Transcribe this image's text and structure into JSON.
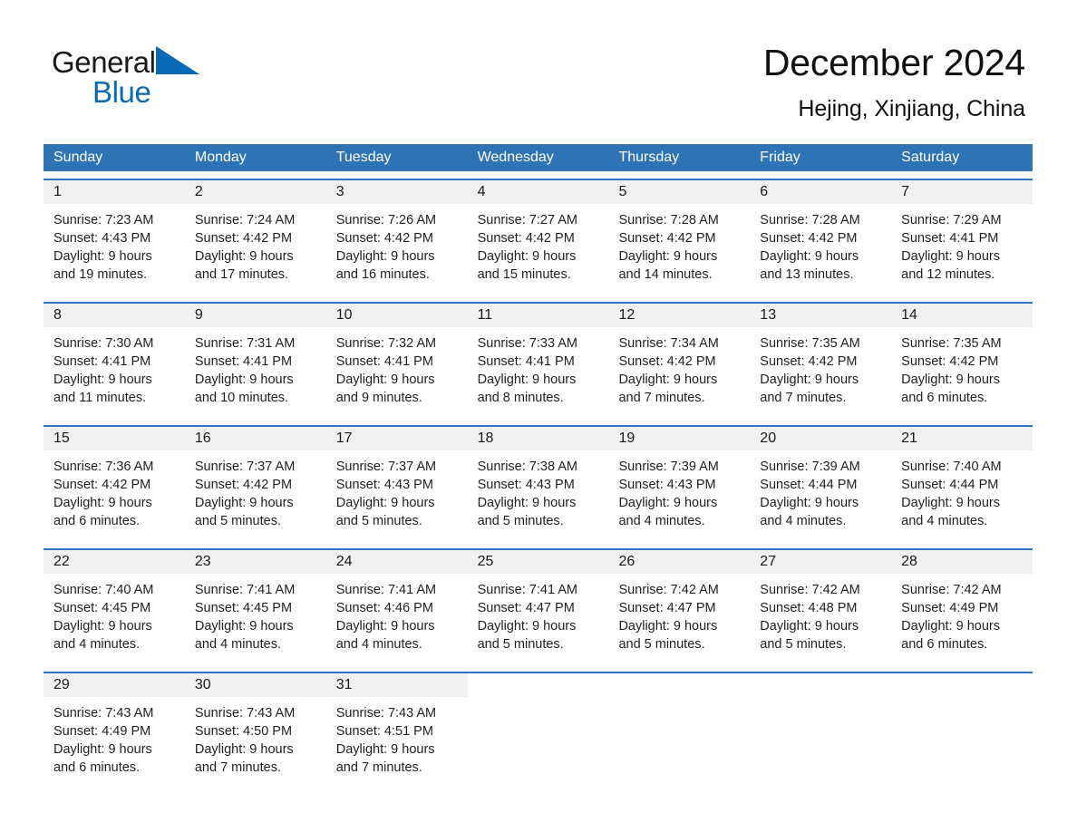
{
  "brand": {
    "word1": "General",
    "word2": "Blue",
    "triangle_color": "#0b68b2",
    "logo_text_color": "#1a1a1a"
  },
  "header": {
    "title": "December 2024",
    "subtitle": "Hejing, Xinjiang, China"
  },
  "theme": {
    "header_blue": "#2e74b5",
    "daynum_band": "#f0f0f0",
    "text": "#1a1a1a"
  },
  "weekday_headers": [
    "Sunday",
    "Monday",
    "Tuesday",
    "Wednesday",
    "Thursday",
    "Friday",
    "Saturday"
  ],
  "weeks": [
    {
      "days": [
        {
          "num": "1",
          "sunrise": "Sunrise: 7:23 AM",
          "sunset": "Sunset: 4:43 PM",
          "daylight1": "Daylight: 9 hours",
          "daylight2": "and 19 minutes."
        },
        {
          "num": "2",
          "sunrise": "Sunrise: 7:24 AM",
          "sunset": "Sunset: 4:42 PM",
          "daylight1": "Daylight: 9 hours",
          "daylight2": "and 17 minutes."
        },
        {
          "num": "3",
          "sunrise": "Sunrise: 7:26 AM",
          "sunset": "Sunset: 4:42 PM",
          "daylight1": "Daylight: 9 hours",
          "daylight2": "and 16 minutes."
        },
        {
          "num": "4",
          "sunrise": "Sunrise: 7:27 AM",
          "sunset": "Sunset: 4:42 PM",
          "daylight1": "Daylight: 9 hours",
          "daylight2": "and 15 minutes."
        },
        {
          "num": "5",
          "sunrise": "Sunrise: 7:28 AM",
          "sunset": "Sunset: 4:42 PM",
          "daylight1": "Daylight: 9 hours",
          "daylight2": "and 14 minutes."
        },
        {
          "num": "6",
          "sunrise": "Sunrise: 7:28 AM",
          "sunset": "Sunset: 4:42 PM",
          "daylight1": "Daylight: 9 hours",
          "daylight2": "and 13 minutes."
        },
        {
          "num": "7",
          "sunrise": "Sunrise: 7:29 AM",
          "sunset": "Sunset: 4:41 PM",
          "daylight1": "Daylight: 9 hours",
          "daylight2": "and 12 minutes."
        }
      ]
    },
    {
      "days": [
        {
          "num": "8",
          "sunrise": "Sunrise: 7:30 AM",
          "sunset": "Sunset: 4:41 PM",
          "daylight1": "Daylight: 9 hours",
          "daylight2": "and 11 minutes."
        },
        {
          "num": "9",
          "sunrise": "Sunrise: 7:31 AM",
          "sunset": "Sunset: 4:41 PM",
          "daylight1": "Daylight: 9 hours",
          "daylight2": "and 10 minutes."
        },
        {
          "num": "10",
          "sunrise": "Sunrise: 7:32 AM",
          "sunset": "Sunset: 4:41 PM",
          "daylight1": "Daylight: 9 hours",
          "daylight2": "and 9 minutes."
        },
        {
          "num": "11",
          "sunrise": "Sunrise: 7:33 AM",
          "sunset": "Sunset: 4:41 PM",
          "daylight1": "Daylight: 9 hours",
          "daylight2": "and 8 minutes."
        },
        {
          "num": "12",
          "sunrise": "Sunrise: 7:34 AM",
          "sunset": "Sunset: 4:42 PM",
          "daylight1": "Daylight: 9 hours",
          "daylight2": "and 7 minutes."
        },
        {
          "num": "13",
          "sunrise": "Sunrise: 7:35 AM",
          "sunset": "Sunset: 4:42 PM",
          "daylight1": "Daylight: 9 hours",
          "daylight2": "and 7 minutes."
        },
        {
          "num": "14",
          "sunrise": "Sunrise: 7:35 AM",
          "sunset": "Sunset: 4:42 PM",
          "daylight1": "Daylight: 9 hours",
          "daylight2": "and 6 minutes."
        }
      ]
    },
    {
      "days": [
        {
          "num": "15",
          "sunrise": "Sunrise: 7:36 AM",
          "sunset": "Sunset: 4:42 PM",
          "daylight1": "Daylight: 9 hours",
          "daylight2": "and 6 minutes."
        },
        {
          "num": "16",
          "sunrise": "Sunrise: 7:37 AM",
          "sunset": "Sunset: 4:42 PM",
          "daylight1": "Daylight: 9 hours",
          "daylight2": "and 5 minutes."
        },
        {
          "num": "17",
          "sunrise": "Sunrise: 7:37 AM",
          "sunset": "Sunset: 4:43 PM",
          "daylight1": "Daylight: 9 hours",
          "daylight2": "and 5 minutes."
        },
        {
          "num": "18",
          "sunrise": "Sunrise: 7:38 AM",
          "sunset": "Sunset: 4:43 PM",
          "daylight1": "Daylight: 9 hours",
          "daylight2": "and 5 minutes."
        },
        {
          "num": "19",
          "sunrise": "Sunrise: 7:39 AM",
          "sunset": "Sunset: 4:43 PM",
          "daylight1": "Daylight: 9 hours",
          "daylight2": "and 4 minutes."
        },
        {
          "num": "20",
          "sunrise": "Sunrise: 7:39 AM",
          "sunset": "Sunset: 4:44 PM",
          "daylight1": "Daylight: 9 hours",
          "daylight2": "and 4 minutes."
        },
        {
          "num": "21",
          "sunrise": "Sunrise: 7:40 AM",
          "sunset": "Sunset: 4:44 PM",
          "daylight1": "Daylight: 9 hours",
          "daylight2": "and 4 minutes."
        }
      ]
    },
    {
      "days": [
        {
          "num": "22",
          "sunrise": "Sunrise: 7:40 AM",
          "sunset": "Sunset: 4:45 PM",
          "daylight1": "Daylight: 9 hours",
          "daylight2": "and 4 minutes."
        },
        {
          "num": "23",
          "sunrise": "Sunrise: 7:41 AM",
          "sunset": "Sunset: 4:45 PM",
          "daylight1": "Daylight: 9 hours",
          "daylight2": "and 4 minutes."
        },
        {
          "num": "24",
          "sunrise": "Sunrise: 7:41 AM",
          "sunset": "Sunset: 4:46 PM",
          "daylight1": "Daylight: 9 hours",
          "daylight2": "and 4 minutes."
        },
        {
          "num": "25",
          "sunrise": "Sunrise: 7:41 AM",
          "sunset": "Sunset: 4:47 PM",
          "daylight1": "Daylight: 9 hours",
          "daylight2": "and 5 minutes."
        },
        {
          "num": "26",
          "sunrise": "Sunrise: 7:42 AM",
          "sunset": "Sunset: 4:47 PM",
          "daylight1": "Daylight: 9 hours",
          "daylight2": "and 5 minutes."
        },
        {
          "num": "27",
          "sunrise": "Sunrise: 7:42 AM",
          "sunset": "Sunset: 4:48 PM",
          "daylight1": "Daylight: 9 hours",
          "daylight2": "and 5 minutes."
        },
        {
          "num": "28",
          "sunrise": "Sunrise: 7:42 AM",
          "sunset": "Sunset: 4:49 PM",
          "daylight1": "Daylight: 9 hours",
          "daylight2": "and 6 minutes."
        }
      ]
    },
    {
      "days": [
        {
          "num": "29",
          "sunrise": "Sunrise: 7:43 AM",
          "sunset": "Sunset: 4:49 PM",
          "daylight1": "Daylight: 9 hours",
          "daylight2": "and 6 minutes."
        },
        {
          "num": "30",
          "sunrise": "Sunrise: 7:43 AM",
          "sunset": "Sunset: 4:50 PM",
          "daylight1": "Daylight: 9 hours",
          "daylight2": "and 7 minutes."
        },
        {
          "num": "31",
          "sunrise": "Sunrise: 7:43 AM",
          "sunset": "Sunset: 4:51 PM",
          "daylight1": "Daylight: 9 hours",
          "daylight2": "and 7 minutes."
        },
        {
          "num": "",
          "sunrise": "",
          "sunset": "",
          "daylight1": "",
          "daylight2": ""
        },
        {
          "num": "",
          "sunrise": "",
          "sunset": "",
          "daylight1": "",
          "daylight2": ""
        },
        {
          "num": "",
          "sunrise": "",
          "sunset": "",
          "daylight1": "",
          "daylight2": ""
        },
        {
          "num": "",
          "sunrise": "",
          "sunset": "",
          "daylight1": "",
          "daylight2": ""
        }
      ]
    }
  ]
}
